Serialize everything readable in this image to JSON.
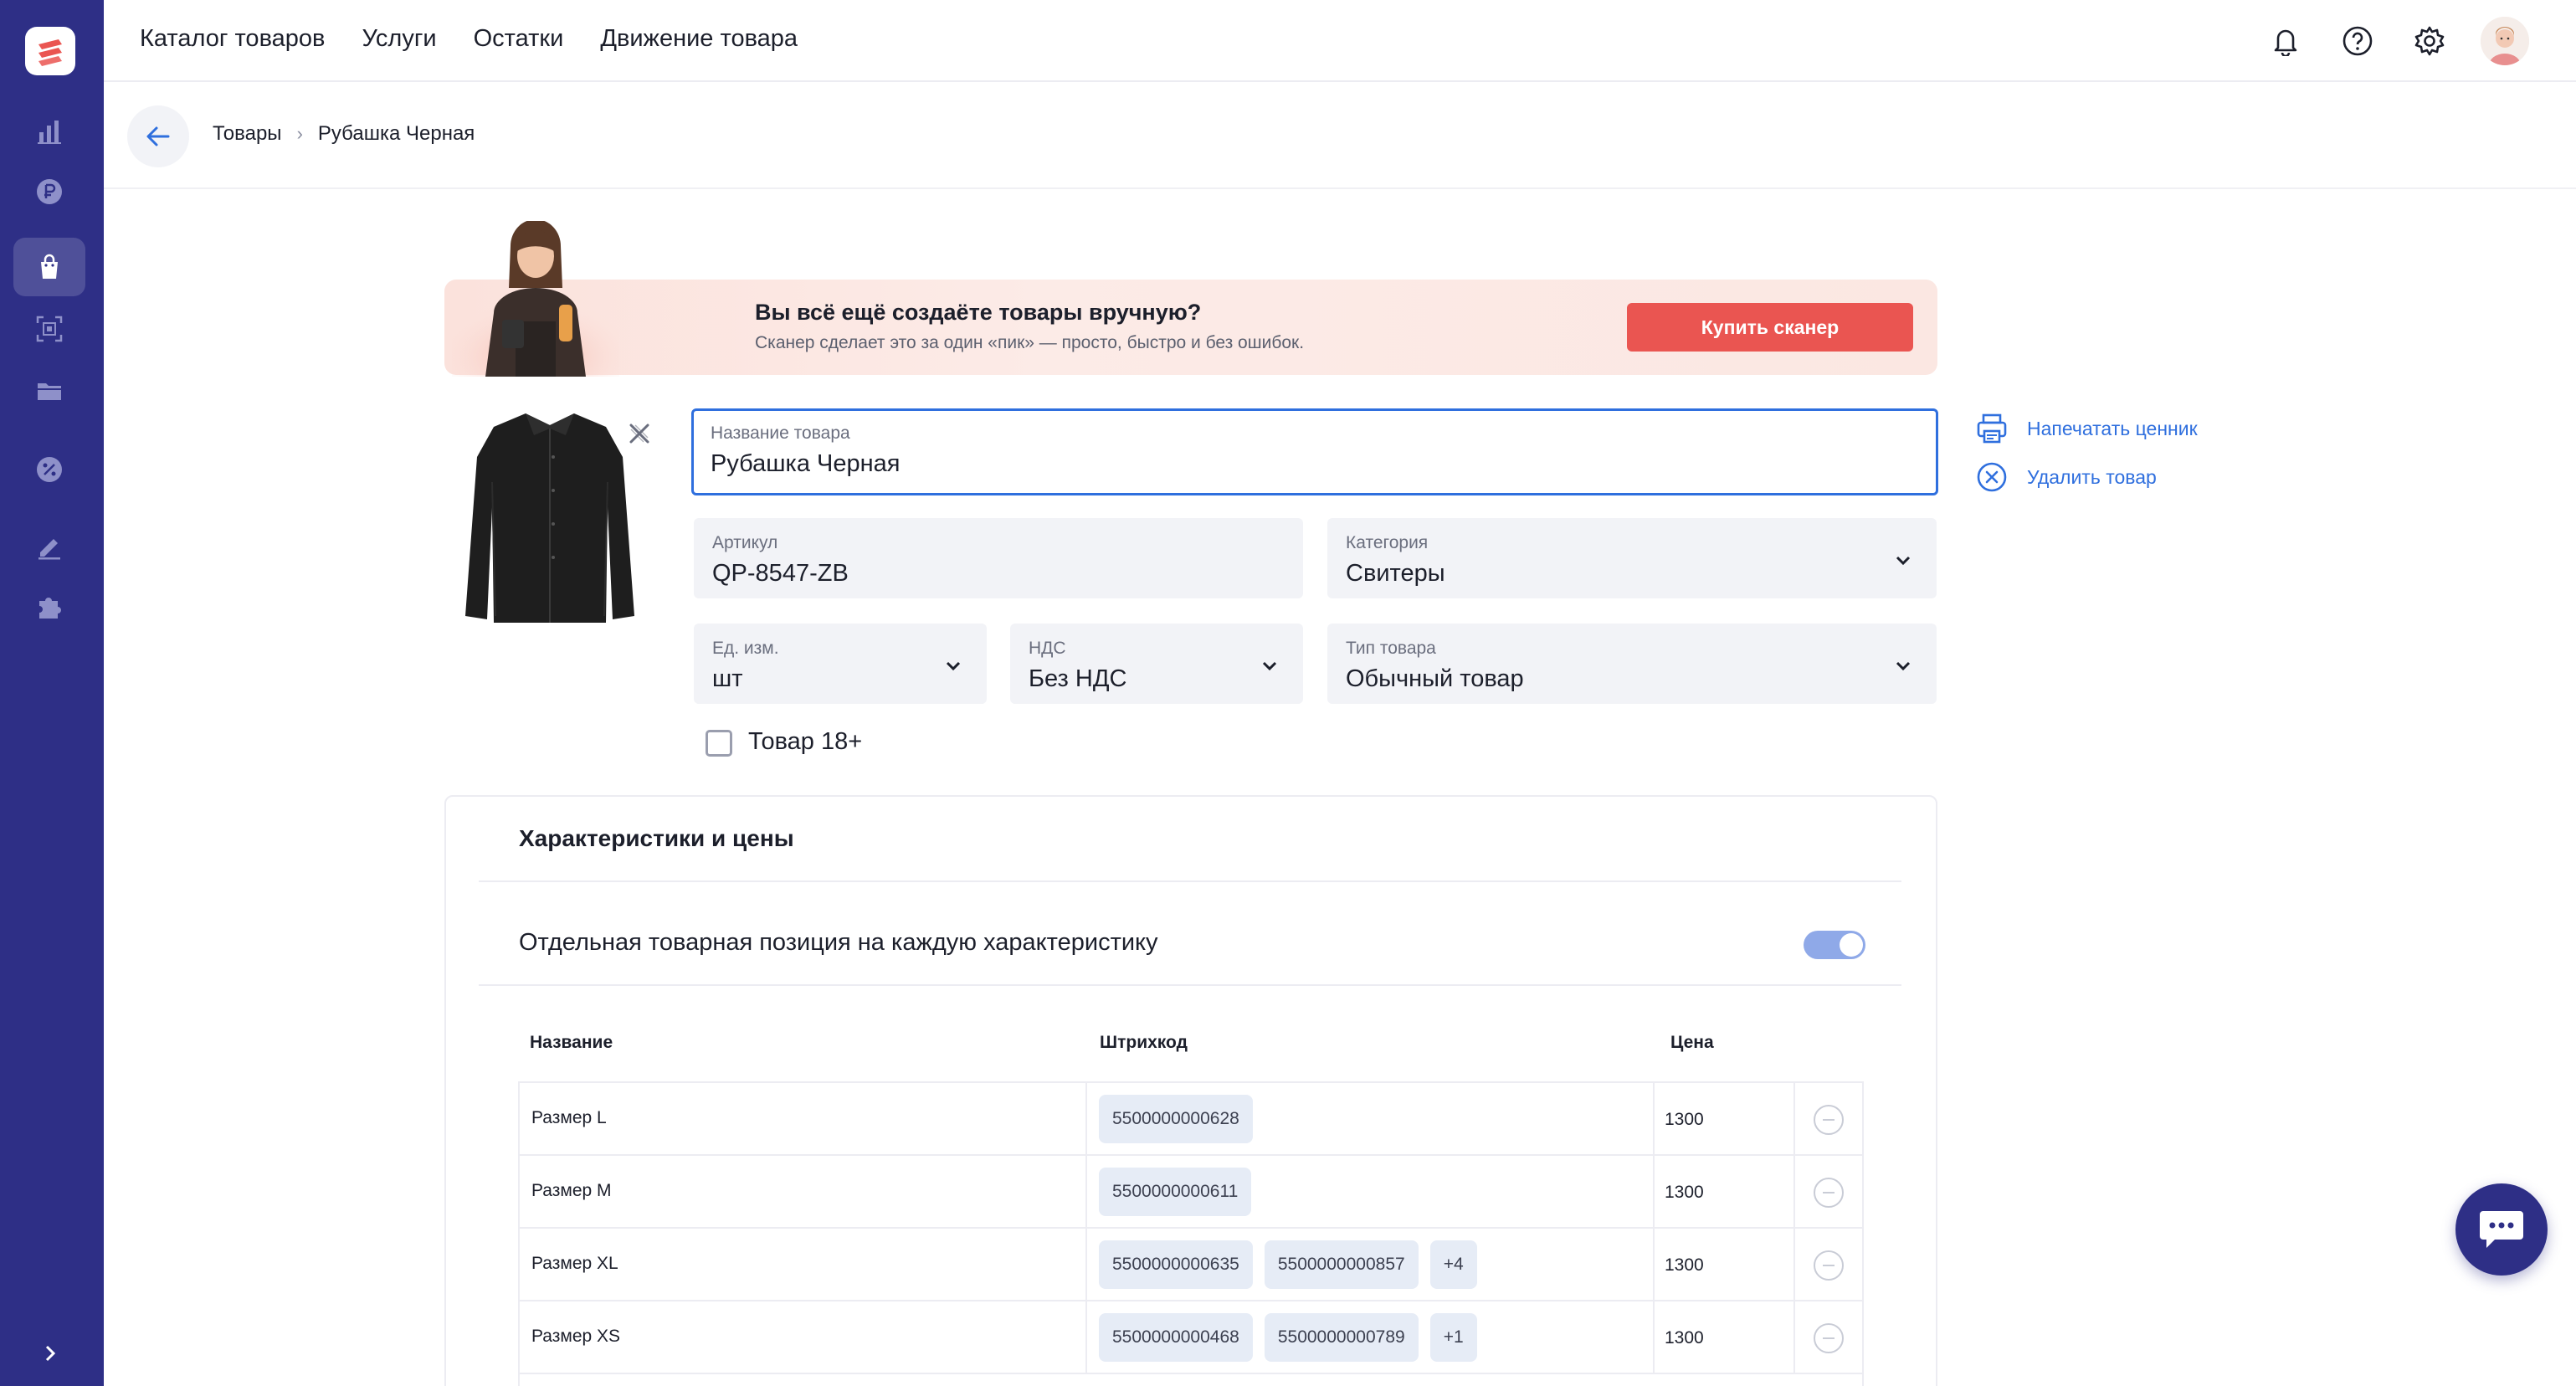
{
  "topnav": {
    "items": [
      "Каталог товаров",
      "Услуги",
      "Остатки",
      "Движение товара"
    ]
  },
  "breadcrumb": {
    "parent": "Товары",
    "current": "Рубашка Черная"
  },
  "banner": {
    "title": "Вы всё ещё создаёте товары вручную?",
    "subtitle": "Сканер сделает это за один «пик» — просто, быстро и без ошибок.",
    "button": "Купить сканер"
  },
  "form": {
    "name": {
      "label": "Название товара",
      "value": "Рубашка Черная"
    },
    "sku": {
      "label": "Артикул",
      "value": "QP-8547-ZB"
    },
    "category": {
      "label": "Категория",
      "value": "Свитеры"
    },
    "unit": {
      "label": "Ед. изм.",
      "value": "шт"
    },
    "vat": {
      "label": "НДС",
      "value": "Без НДС"
    },
    "type": {
      "label": "Тип товара",
      "value": "Обычный товар"
    },
    "adult": {
      "label": "Товар 18+",
      "checked": false
    }
  },
  "actions": {
    "print": "Напечатать ценник",
    "delete": "Удалить товар"
  },
  "characteristics": {
    "title": "Характеристики и цены",
    "toggle_label": "Отдельная товарная позиция на каждую характеристику",
    "toggle_on": true,
    "columns": [
      "Название",
      "Штрихкод",
      "Цена"
    ],
    "rows": [
      {
        "name": "Размер L",
        "barcodes": [
          "5500000000628"
        ],
        "more": "",
        "price": "1300"
      },
      {
        "name": "Размер M",
        "barcodes": [
          "5500000000611"
        ],
        "more": "",
        "price": "1300"
      },
      {
        "name": "Размер XL",
        "barcodes": [
          "5500000000635",
          "5500000000857"
        ],
        "more": "+4",
        "price": "1300"
      },
      {
        "name": "Размер XS",
        "barcodes": [
          "5500000000468",
          "5500000000789"
        ],
        "more": "+1",
        "price": "1300"
      }
    ]
  },
  "colors": {
    "sidebar": "#2e2f86",
    "accent": "#2f6fde",
    "buy_button": "#ea5551",
    "chip": "#e6ecf6"
  },
  "icons": {
    "sidebar": [
      "chart-icon",
      "ruble-icon",
      "bag-icon",
      "scan-icon",
      "folder-icon",
      "discount-icon",
      "edit-icon",
      "puzzle-icon"
    ],
    "top": [
      "bell-icon",
      "help-icon",
      "gear-icon",
      "avatar"
    ]
  }
}
